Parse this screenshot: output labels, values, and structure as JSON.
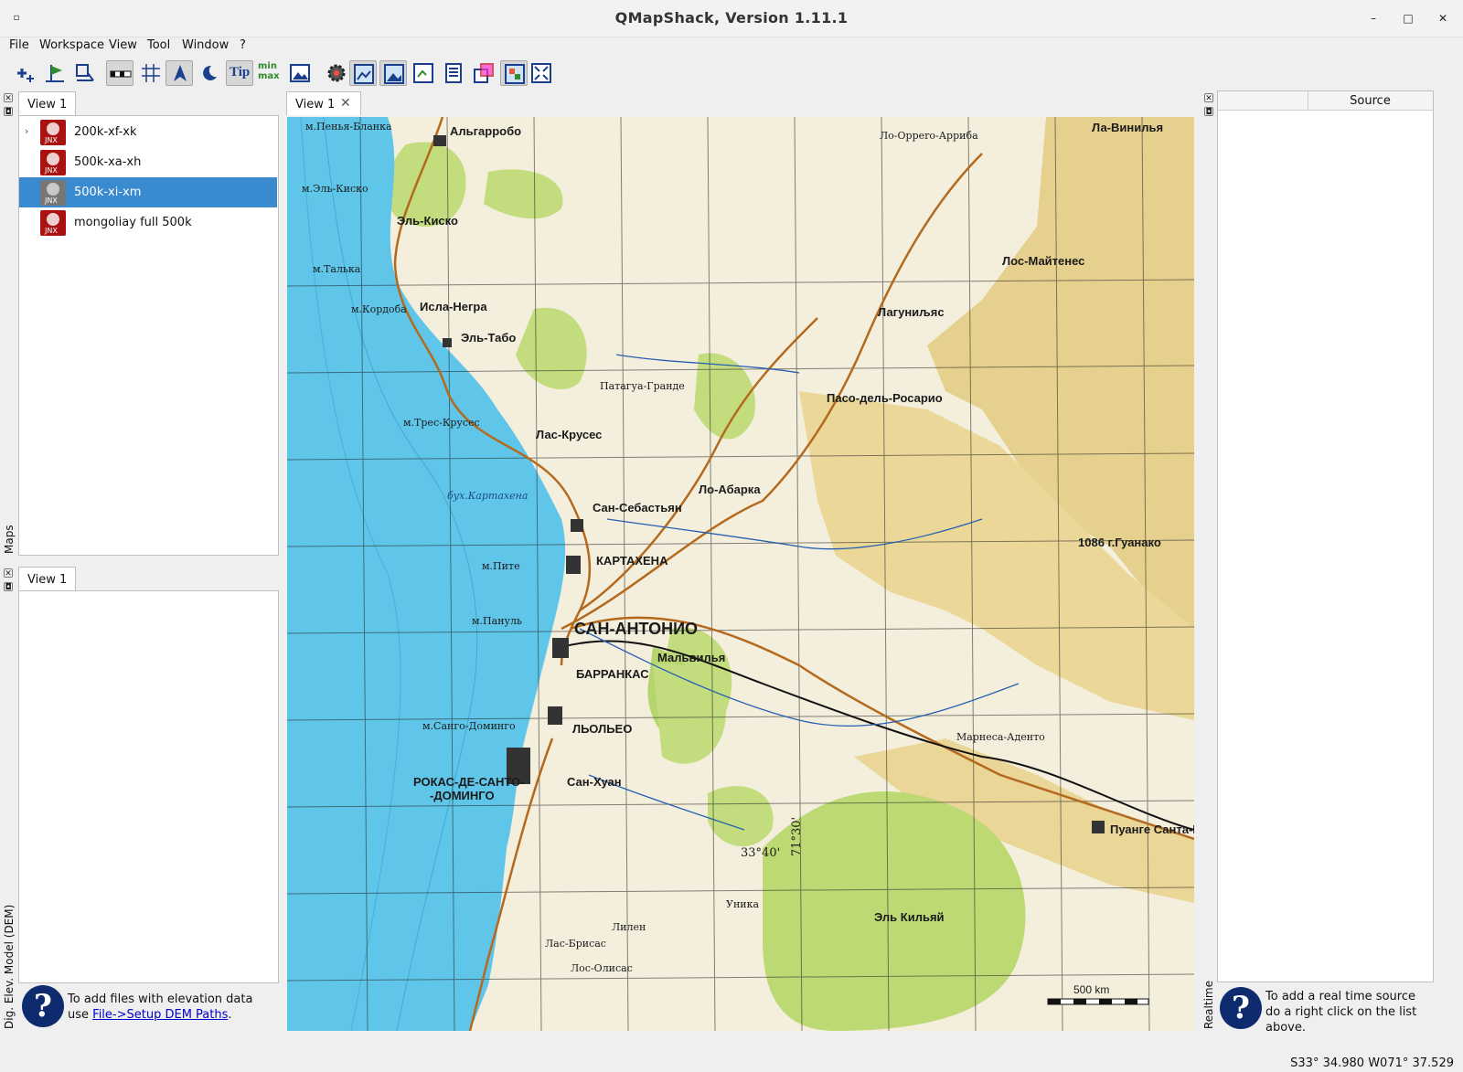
{
  "window": {
    "title": "QMapShack, Version 1.11.1",
    "minimize": "–",
    "maximize": "□",
    "close": "✕"
  },
  "menu": [
    "File",
    "Workspace",
    "View",
    "Tool",
    "Window",
    "?"
  ],
  "toolbar": {
    "buttons": [
      {
        "icon": "add-map-icon",
        "active": false
      },
      {
        "icon": "flag-icon",
        "active": false
      },
      {
        "icon": "workspace-icon",
        "active": false
      },
      {
        "icon": "scale-icon",
        "active": true
      },
      {
        "icon": "grid-icon",
        "active": false
      },
      {
        "icon": "north-arrow-icon",
        "active": true
      },
      {
        "icon": "night-icon",
        "active": false
      },
      {
        "icon": "tooltip-icon",
        "active": true,
        "text": "Tip"
      },
      {
        "icon": "minmax-icon",
        "active": false,
        "text": "min max"
      },
      {
        "icon": "image-icon",
        "active": false
      },
      {
        "icon": "settings-gear-icon",
        "active": false
      },
      {
        "icon": "map-view-icon",
        "active": true
      },
      {
        "icon": "map-view-2-icon",
        "active": true
      },
      {
        "icon": "map-view-3-icon",
        "active": false
      },
      {
        "icon": "map-view-4-icon",
        "active": false
      },
      {
        "icon": "map-view-5-icon",
        "active": false
      },
      {
        "icon": "map-view-6-icon",
        "active": true
      },
      {
        "icon": "fullscreen-icon",
        "active": false
      }
    ]
  },
  "maps_dock": {
    "side_label": "Maps",
    "tab": "View 1",
    "items": [
      {
        "label": "200k-xf-xk",
        "expander": "›",
        "selected": false
      },
      {
        "label": "500k-xa-xh",
        "expander": "",
        "selected": false
      },
      {
        "label": "500k-xi-xm",
        "expander": "",
        "selected": true
      },
      {
        "label": "mongoliay full 500k",
        "expander": "",
        "selected": false
      }
    ],
    "icon_text": "JNX"
  },
  "dem_dock": {
    "side_label": "Dig. Elev. Model (DEM)",
    "tab": "View 1",
    "help_text": "To add files with elevation data use ",
    "help_link": "File->Setup DEM Paths",
    "help_tail": "."
  },
  "center": {
    "tab": "View 1",
    "close": "✕"
  },
  "realtime_dock": {
    "side_label": "Realtime",
    "column": "Source",
    "help_text": "To add a real time source do a right click on the list above."
  },
  "map": {
    "scale_label": "500 km",
    "labels": [
      "м.Пенья-Бланка",
      "Альгарробо",
      "м.Эль-Киско",
      "Эль-Киско",
      "м.Талька",
      "м.Кордоба",
      "Исла-Негра",
      "Эль-Табо",
      "м.Трес-Крусес",
      "Лас-Крусес",
      "Сан-Себастьян",
      "КАРТАХЕНА",
      "м.Пите",
      "м.Пануль",
      "САН-АНТОНИО",
      "БАРРАНКАС",
      "м.Санго-Доминго",
      "ЛЬОЛЬЕО",
      "РОКАС-ДЕ-САНТО-",
      "-ДОМИНГО",
      "Сан-Хуан",
      "Лo-Абарка",
      "бух.Картахена",
      "Патагуа-Гранде",
      "Пасо-дель-Росарио",
      "Лагуниљяс",
      "Лос-Майтенес",
      "Ла-Винилья",
      "Ло-Орреrо-Арриба",
      "1086 г.Гуанако",
      "Мальвилья",
      "Марнеса-Аденто",
      "Пуанге Санта-Ро",
      "Эль Кильяй",
      "33°40'",
      "71°30'",
      "Уника",
      "Лилен",
      "Лас-Брисас",
      "Лос-Олисас"
    ]
  },
  "status": {
    "coords": "S33° 34.980 W071° 37.529"
  },
  "colors": {
    "selection": "#3a8ad0",
    "sea": "#5fc6ea",
    "land": "#f4eedd",
    "forest": "#c2dc7e",
    "hills": "#e6d08e"
  }
}
